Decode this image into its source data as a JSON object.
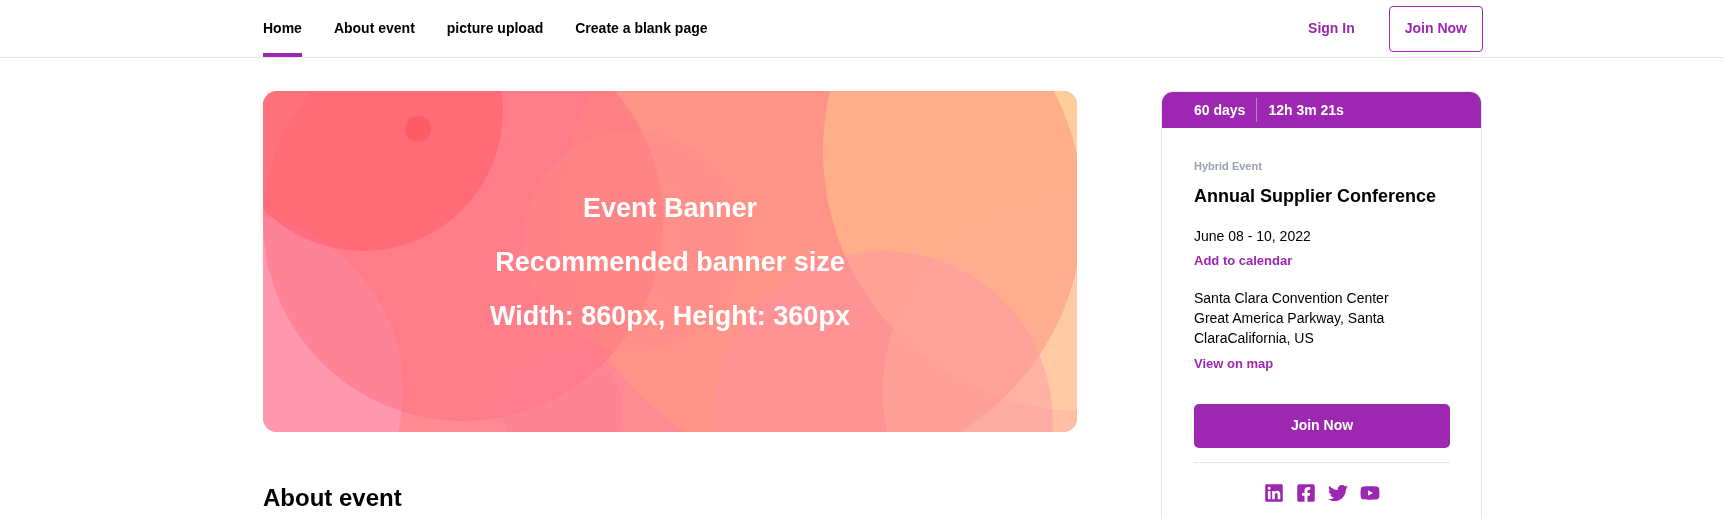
{
  "nav": {
    "links": [
      {
        "label": "Home",
        "selected": true
      },
      {
        "label": "About event",
        "selected": false
      },
      {
        "label": "picture upload",
        "selected": false
      },
      {
        "label": "Create a blank page",
        "selected": false
      }
    ],
    "sign_in": "Sign In",
    "join_button": "Join Now"
  },
  "banner": {
    "lines": [
      "Event Banner",
      "Recommended banner size",
      "Width: 860px, Height: 360px"
    ]
  },
  "countdown": {
    "days": "60 days",
    "time": "12h 3m 21s"
  },
  "event": {
    "type": "Hybrid Event",
    "title": "Annual Supplier Conference",
    "date": "June 08 - 10, 2022",
    "calendar_link": "Add to calendar",
    "address_lines": [
      "Santa Clara Convention Center",
      "Great America Parkway, Santa",
      "ClaraCalifornia, US"
    ],
    "map_link": "View on map",
    "join_button": "Join Now"
  },
  "about": {
    "heading": "About event"
  }
}
